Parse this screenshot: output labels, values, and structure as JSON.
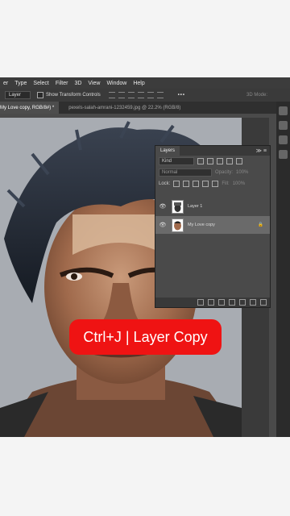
{
  "menubar": {
    "items": [
      "er",
      "Type",
      "Select",
      "Filter",
      "3D",
      "View",
      "Window",
      "Help"
    ]
  },
  "options": {
    "auto_select_value": "Layer",
    "show_transform_label": "Show Transform Controls",
    "mode_3d_label": "3D Mode:"
  },
  "tabs": {
    "active": "My Love copy, RGB/8#) *",
    "inactive": "pexels-salah-amrani-1232459.jpg @ 22.2% (RGB/8)"
  },
  "layers_panel": {
    "title": "Layers",
    "kind_label": "Kind",
    "blend_mode": "Normal",
    "opacity_label": "Opacity:",
    "opacity_value": "100%",
    "lock_label": "Lock:",
    "fill_label": "Fill:",
    "fill_value": "100%",
    "layers": [
      {
        "name": "Layer 1",
        "selected": false
      },
      {
        "name": "My Love copy",
        "selected": true
      }
    ]
  },
  "caption": "Ctrl+J | Layer Copy",
  "colors": {
    "caption_bg": "#ef1313",
    "ps_dark": "#3a3a3a",
    "canvas_bg": "#a8acb2"
  }
}
